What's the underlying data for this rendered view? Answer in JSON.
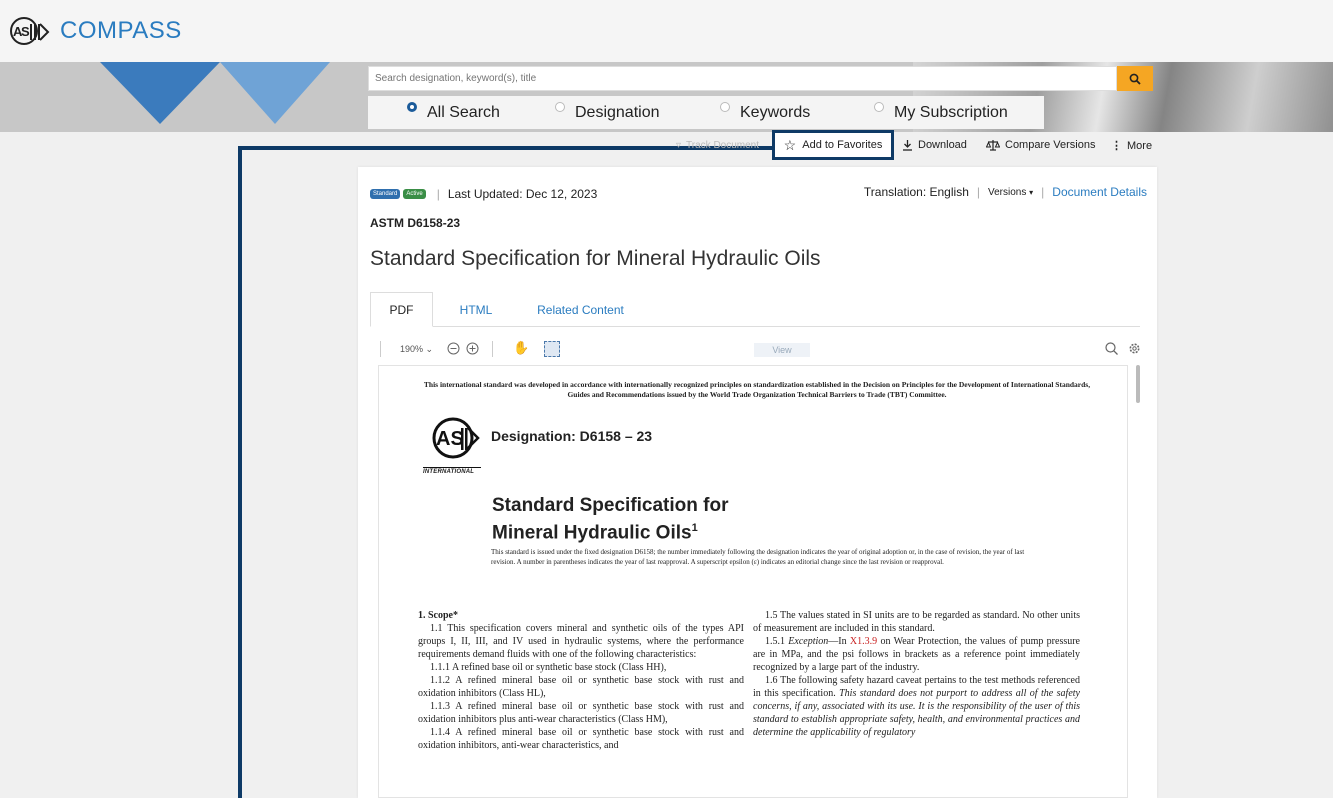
{
  "app": {
    "brand": "COMPASS"
  },
  "search": {
    "placeholder": "Search designation, keyword(s), title",
    "scopes": [
      {
        "label": "All Search",
        "selected": true
      },
      {
        "label": "Designation",
        "selected": false
      },
      {
        "label": "Keywords",
        "selected": false
      },
      {
        "label": "My Subscription",
        "selected": false
      }
    ]
  },
  "toolbar": {
    "track": "Track Document",
    "favorites": "Add to Favorites",
    "download": "Download",
    "compare": "Compare Versions",
    "more": "More"
  },
  "document": {
    "badge_standard": "Standard",
    "badge_active": "Active",
    "last_updated": "Last Updated: Dec 12, 2023",
    "translation": "Translation: English",
    "versions": "Versions",
    "details": "Document Details",
    "id": "ASTM D6158-23",
    "title": "Standard Specification for Mineral Hydraulic Oils",
    "tabs": [
      "PDF",
      "HTML",
      "Related Content"
    ],
    "active_tab": "PDF"
  },
  "pdf_viewer": {
    "zoom": "190%",
    "view_label": "View",
    "page": {
      "intro": "This international standard was developed in accordance with internationally recognized principles on standardization established in the Decision on Principles for the Development of International Standards, Guides and Recommendations issued by the World Trade Organization Technical Barriers to Trade (TBT) Committee.",
      "logo_caption": "INTERNATIONAL",
      "designation": "Designation: D6158 – 23",
      "title_line1": "Standard Specification for",
      "title_line2": "Mineral Hydraulic Oils",
      "title_sup": "1",
      "note": "This standard is issued under the fixed designation D6158; the number immediately following the designation indicates the year of original adoption or, in the case of revision, the year of last revision. A number in parentheses indicates the year of last reapproval. A superscript epsilon (ε) indicates an editorial change since the last revision or reapproval.",
      "scope_heading": "1. Scope*",
      "left_paras": [
        "1.1 This specification covers mineral and synthetic oils of the types API groups I, II, III, and IV used in hydraulic systems, where the performance requirements demand fluids with one of the following characteristics:",
        "1.1.1 A refined base oil or synthetic base stock (Class HH),",
        "1.1.2 A refined mineral base oil or synthetic base stock with rust and oxidation inhibitors (Class HL),",
        "1.1.3 A refined mineral base oil or synthetic base stock with rust and oxidation inhibitors plus anti-wear characteristics (Class HM),",
        "1.1.4 A refined mineral base oil or synthetic base stock with rust and oxidation inhibitors, anti-wear characteristics, and"
      ],
      "right_p1": "1.5 The values stated in SI units are to be regarded as standard. No other units of measurement are included in this standard.",
      "right_p2_a": "1.5.1 ",
      "right_p2_exc": "Exception",
      "right_p2_b": "—In ",
      "right_p2_link": "X1.3.9",
      "right_p2_c": " on Wear Protection, the values of pump pressure are in MPa, and the psi follows in brackets as a reference point immediately recognized by a large part of the industry.",
      "right_p3_a": "1.6 The following safety hazard caveat pertains to the test methods referenced in this specification. ",
      "right_p3_it": "This standard does not purport to address all of the safety concerns, if any, associated with its use. It is the responsibility of the user of this standard to establish appropriate safety, health, and environmental practices and determine the applicability of regulatory"
    }
  },
  "colors": {
    "brand_blue": "#2a7cc0",
    "navy_frame": "#0e3a66",
    "search_orange": "#f5a623"
  }
}
